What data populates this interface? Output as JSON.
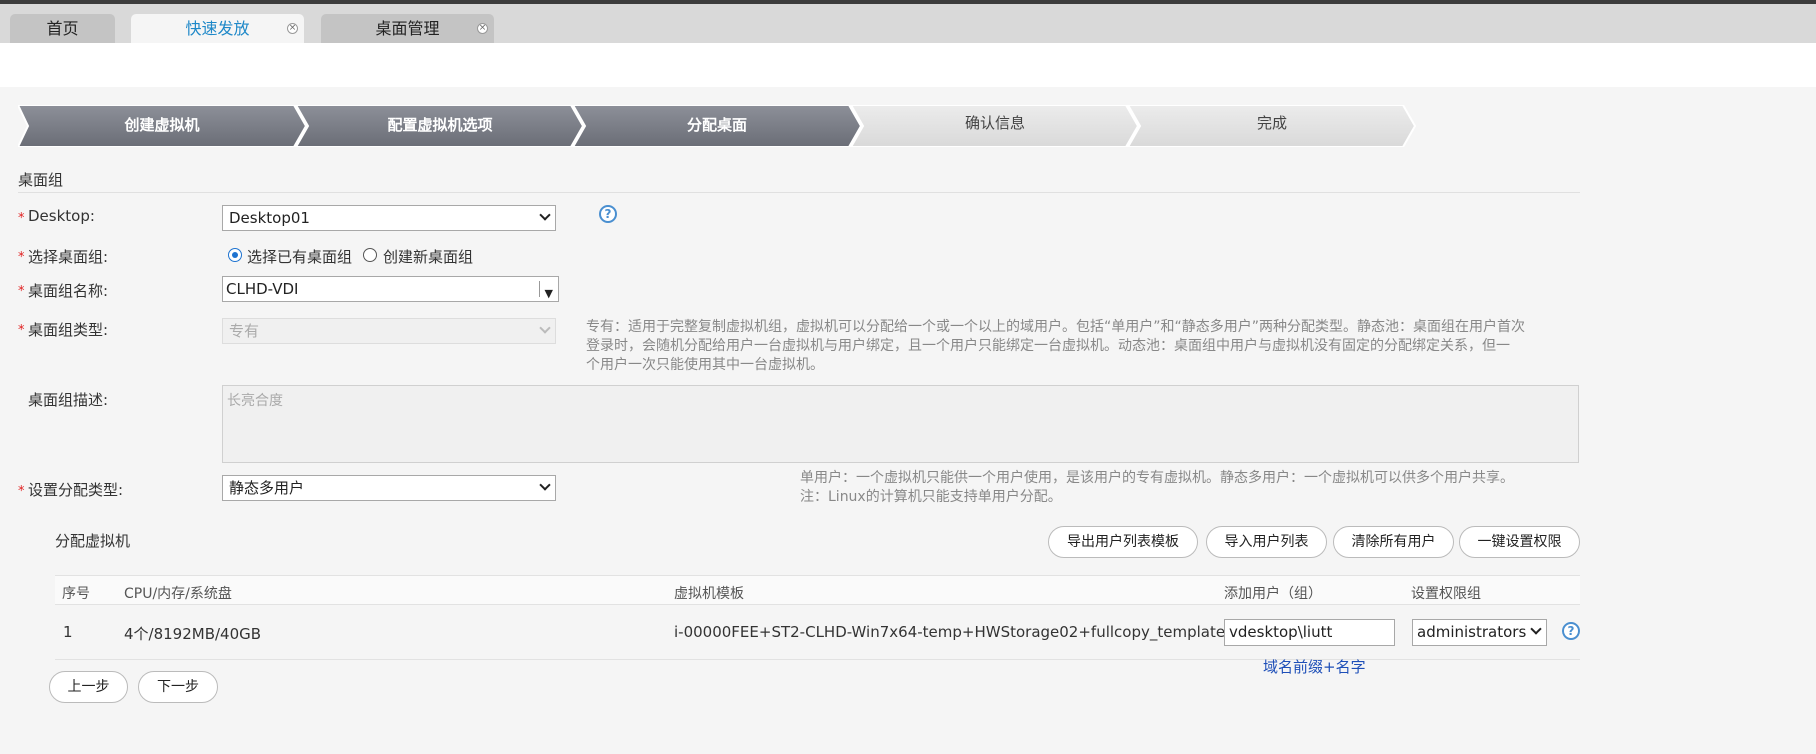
{
  "tabs": [
    {
      "label": "首页",
      "active": false,
      "closable": false
    },
    {
      "label": "快速发放",
      "active": true,
      "closable": true
    },
    {
      "label": "桌面管理",
      "active": false,
      "closable": true
    }
  ],
  "steps": [
    {
      "label": "创建虚拟机",
      "done": true
    },
    {
      "label": "配置虚拟机选项",
      "done": true
    },
    {
      "label": "分配桌面",
      "done": true
    },
    {
      "label": "确认信息",
      "done": false
    },
    {
      "label": "完成",
      "done": false
    }
  ],
  "section": {
    "title": "桌面组"
  },
  "form": {
    "required_mark": "*",
    "desktop": {
      "label": "Desktop:",
      "value": "Desktop01"
    },
    "group_choice": {
      "label": "选择桌面组:",
      "option_existing": "选择已有桌面组",
      "option_new": "创建新桌面组",
      "selected": "existing"
    },
    "group_name": {
      "label": "桌面组名称:",
      "value": "CLHD-VDI"
    },
    "group_type": {
      "label": "桌面组类型:",
      "value": "专有",
      "hint_lines": [
        "专有：适用于完整复制虚拟机组，虚拟机可以分配给一个或一个以上的域用户。包括“单用户”和“静态多用户”两种分配类型。静态池：桌面组在用户首次",
        "登录时，会随机分配给用户一台虚拟机与用户绑定，且一个用户只能绑定一台虚拟机。动态池：桌面组中用户与虚拟机没有固定的分配绑定关系，但一",
        "个用户一次只能使用其中一台虚拟机。"
      ]
    },
    "group_desc": {
      "label": "桌面组描述:",
      "value": "长亮合度"
    },
    "assign_type": {
      "label": "设置分配类型:",
      "value": "静态多用户",
      "hint_lines": [
        "单用户：一个虚拟机只能供一个用户使用，是该用户的专有虚拟机。静态多用户：一个虚拟机可以供多个用户共享。",
        "注：Linux的计算机只能支持单用户分配。"
      ]
    }
  },
  "assign": {
    "title": "分配虚拟机",
    "buttons": [
      "导出用户列表模板",
      "导入用户列表",
      "清除所有用户",
      "一键设置权限"
    ],
    "columns": [
      "序号",
      "CPU/内存/系统盘",
      "虚拟机模板",
      "添加用户（组）",
      "设置权限组"
    ],
    "rows": [
      {
        "index": "1",
        "spec": "4个/8192MB/40GB",
        "template": "i-00000FEE+ST2-CLHD-Win7x64-temp+HWStorage02+fullcopy_template",
        "user": "vdesktop\\liutt",
        "perm": "administrators"
      }
    ],
    "note": "域名前缀+名字"
  },
  "nav": {
    "prev": "上一步",
    "next": "下一步"
  },
  "colors": {
    "accent": "#1e88c8",
    "step_done": "#7a7d86",
    "step_todo": "#e3e3e3",
    "required": "#e02020",
    "note": "#1e4fb8"
  },
  "icons": {
    "help": "?",
    "close": "×"
  }
}
